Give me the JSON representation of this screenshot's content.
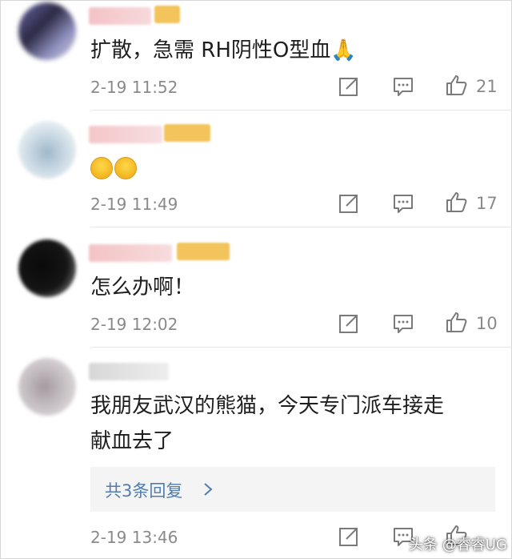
{
  "comments": [
    {
      "text": "扩散，急需 RH阴性O型血🙏",
      "time": "2-19 11:52",
      "likes": "21"
    },
    {
      "text": "",
      "emoji_icons": [
        "crying-face-icon",
        "crying-face-icon"
      ],
      "time": "2-19 11:49",
      "likes": "17"
    },
    {
      "text": "怎么办啊！",
      "time": "2-19 12:02",
      "likes": "10"
    },
    {
      "text_line1": "我朋友武汉的熊猫，今天专门派车接走",
      "text_line2": "献血去了",
      "replies_label": "共3条回复",
      "time": "2-19 13:46"
    }
  ],
  "icons": {
    "share": "share-icon",
    "comment": "comment-icon",
    "like": "thumbs-up-icon",
    "chevron": "chevron-right-icon"
  },
  "colors": {
    "link": "#507daf",
    "meta": "#8a8a8a",
    "text": "#1e1e1e",
    "badge": "#f3c45c"
  },
  "watermark": "头条 @睿睿UG"
}
